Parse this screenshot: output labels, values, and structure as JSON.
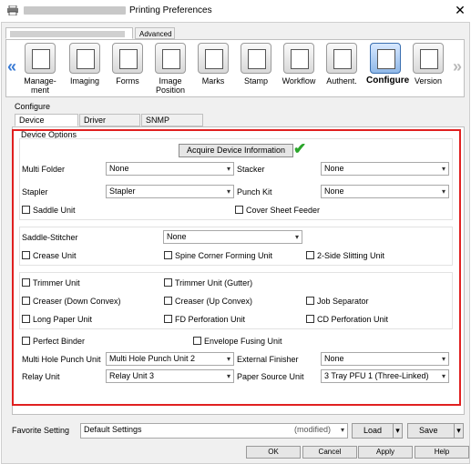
{
  "window": {
    "title": "Printing Preferences",
    "close_glyph": "✕"
  },
  "top_tabs": {
    "advanced": "Advanced"
  },
  "toolbar": {
    "prev_glyph": "«",
    "next_glyph": "»",
    "items": [
      {
        "label": "Manage-\nment",
        "icon": "management-icon"
      },
      {
        "label": "Imaging",
        "icon": "imaging-icon"
      },
      {
        "label": "Forms",
        "icon": "forms-icon"
      },
      {
        "label": "Image\nPosition",
        "icon": "image-position-icon"
      },
      {
        "label": "Marks",
        "icon": "marks-icon"
      },
      {
        "label": "Stamp",
        "icon": "stamp-icon"
      },
      {
        "label": "Workflow",
        "icon": "workflow-icon"
      },
      {
        "label": "Authent.",
        "icon": "authentication-icon"
      },
      {
        "label": "Configure",
        "icon": "configure-icon",
        "selected": true
      },
      {
        "label": "Version",
        "icon": "version-icon"
      }
    ]
  },
  "configure": {
    "title": "Configure",
    "tabs": [
      "Device Options",
      "Driver Options",
      "SNMP Settings"
    ],
    "group_title": "Device Options",
    "acquire_button": "Acquire Device Information",
    "multi_folder": {
      "label": "Multi Folder",
      "value": "None"
    },
    "stacker": {
      "label": "Stacker",
      "value": "None"
    },
    "stapler": {
      "label": "Stapler",
      "value": "Stapler"
    },
    "punch_kit": {
      "label": "Punch Kit",
      "value": "None"
    },
    "saddle_unit": "Saddle Unit",
    "cover_sheet_feeder": "Cover Sheet Feeder",
    "saddle_stitcher": {
      "label": "Saddle-Stitcher",
      "value": "None"
    },
    "crease_unit": "Crease Unit",
    "spine_corner": "Spine Corner Forming Unit",
    "two_side_slitting": "2-Side Slitting Unit",
    "trimmer_unit": "Trimmer Unit",
    "trimmer_gutter": "Trimmer Unit (Gutter)",
    "creaser_down": "Creaser (Down Convex)",
    "creaser_up": "Creaser (Up Convex)",
    "job_separator": "Job Separator",
    "long_paper": "Long Paper Unit",
    "fd_perforation": "FD Perforation Unit",
    "cd_perforation": "CD Perforation Unit",
    "perfect_binder": "Perfect Binder",
    "envelope_fusing": "Envelope Fusing Unit",
    "multi_hole_punch": {
      "label": "Multi Hole Punch Unit",
      "value": "Multi Hole Punch Unit 2"
    },
    "multi_finisher": {
      "label": "External Finisher",
      "value": "None"
    },
    "relay_unit": {
      "label": "Relay Unit",
      "value": "Relay Unit 3"
    },
    "paper_source": {
      "label": "Paper Source Unit",
      "value": "3 Tray PFU 1 (Three-Linked)"
    }
  },
  "footer": {
    "favorite_label": "Favorite Setting",
    "favorite_value": "Default Settings",
    "favorite_modified": "(modified)",
    "load": "Load",
    "save": "Save",
    "ok": "OK",
    "cancel": "Cancel",
    "apply": "Apply",
    "help": "Help"
  },
  "colors": {
    "highlight_frame": "#e02020",
    "check": "#2aa52a",
    "nav_arrow": "#3a7bd5"
  }
}
